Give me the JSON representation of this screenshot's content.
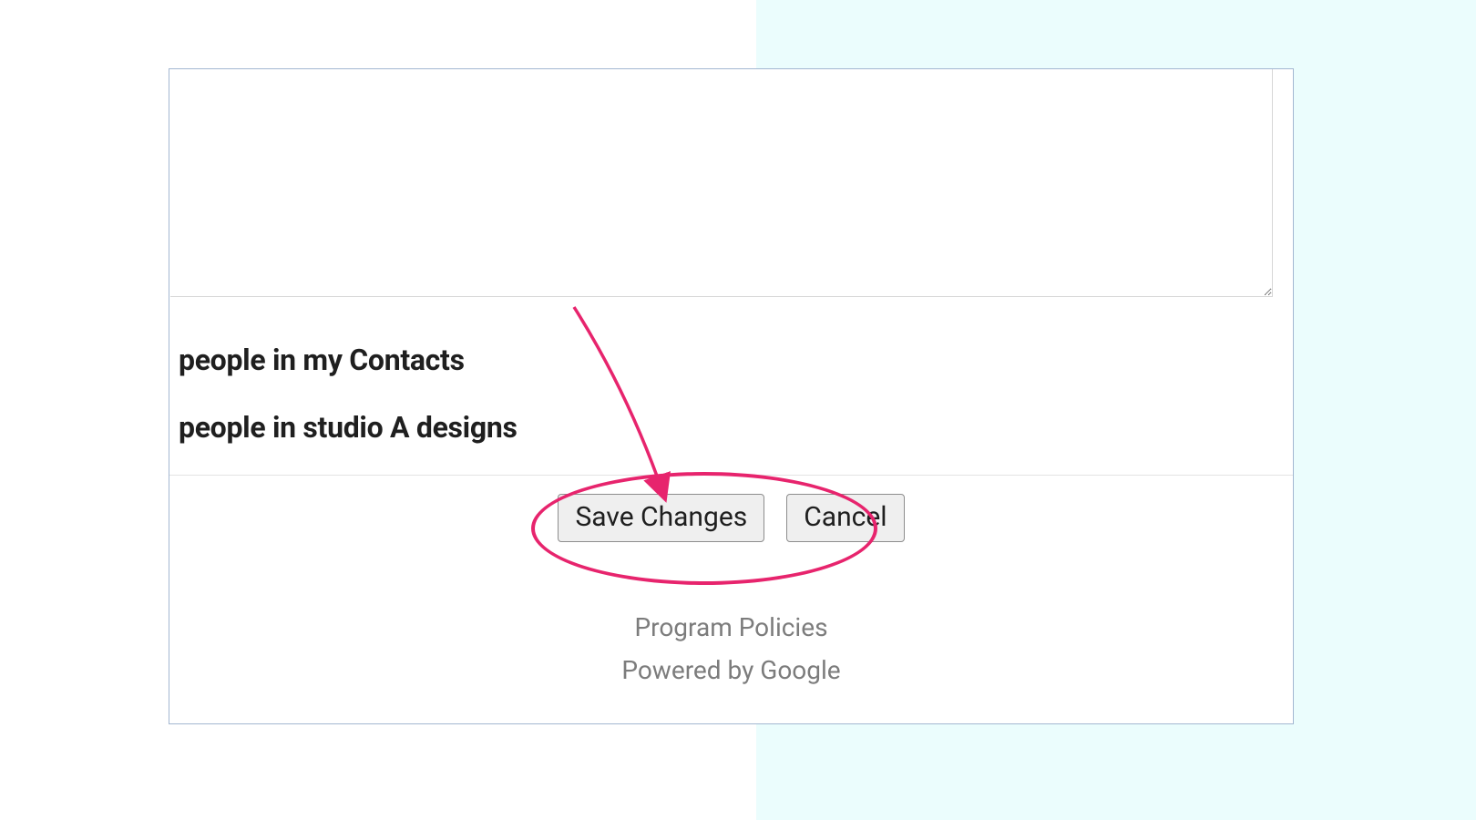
{
  "options": {
    "line1": "people in my Contacts",
    "line2": "people in studio A designs"
  },
  "buttons": {
    "save": "Save Changes",
    "cancel": "Cancel"
  },
  "footer": {
    "policies": "Program Policies",
    "powered": "Powered by Google"
  },
  "textarea": {
    "value": ""
  },
  "annotation": {
    "color": "#e7246d"
  }
}
